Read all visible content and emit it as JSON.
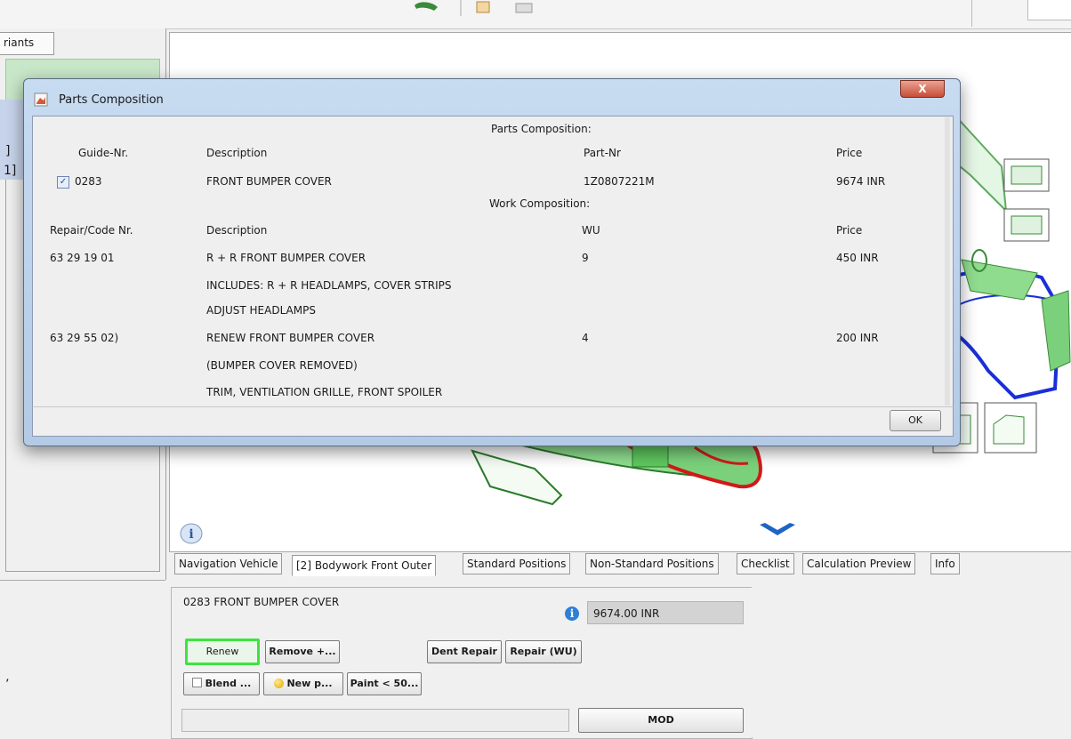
{
  "variants_tab": "riants",
  "left": {
    "bracket_1": "]",
    "bracket_2": "1]",
    "bottom_char": "’"
  },
  "dialog": {
    "title": "Parts Composition",
    "close_glyph": "X",
    "parts_heading": "Parts Composition:",
    "parts_headers": {
      "guide": "Guide-Nr.",
      "description": "Description",
      "part": "Part-Nr",
      "price": "Price"
    },
    "parts_row": {
      "guide": "0283",
      "description": "FRONT BUMPER COVER",
      "part": "1Z0807221M",
      "price": "9674 INR",
      "checked": true
    },
    "work_heading": "Work Composition:",
    "work_headers": {
      "code": "Repair/Code Nr.",
      "description": "Description",
      "wu": "WU",
      "price": "Price"
    },
    "work_rows": [
      {
        "code": "63 29 19 01",
        "description": "R + R FRONT BUMPER COVER",
        "wu": "9",
        "price": "450 INR"
      },
      {
        "code": "",
        "description": "INCLUDES: R + R HEADLAMPS, COVER STRIPS",
        "wu": "",
        "price": ""
      },
      {
        "code": "",
        "description": "ADJUST HEADLAMPS",
        "wu": "",
        "price": ""
      },
      {
        "code": "63 29 55 02)",
        "description": "RENEW FRONT BUMPER COVER",
        "wu": "4",
        "price": "200 INR"
      },
      {
        "code": "",
        "description": "(BUMPER COVER REMOVED)",
        "wu": "",
        "price": ""
      },
      {
        "code": "",
        "description": "TRIM, VENTILATION GRILLE, FRONT SPOILER",
        "wu": "",
        "price": ""
      }
    ],
    "ok_label": "OK"
  },
  "canvas": {
    "info_glyph": "i"
  },
  "tabs": [
    "Navigation Vehicle",
    "[2] Bodywork Front Outer",
    "Standard Positions",
    "Non-Standard Positions",
    "Checklist",
    "Calculation Preview",
    "Info"
  ],
  "bottom": {
    "part_line": "0283 FRONT BUMPER COVER",
    "info_glyph": "i",
    "price_value": "9674.00 INR",
    "buttons": {
      "renew": "Renew",
      "remove": "Remove +...",
      "dent": "Dent Repair",
      "repair": "Repair (WU)",
      "blend": "Blend ...",
      "newp": "New p...",
      "paint": "Paint < 50...",
      "mod": "MOD"
    }
  },
  "colors": {
    "accent_green": "#3ee33e",
    "outline_blue": "#1a2fd8",
    "outline_red": "#d21919",
    "part_green": "#6ed36e"
  }
}
